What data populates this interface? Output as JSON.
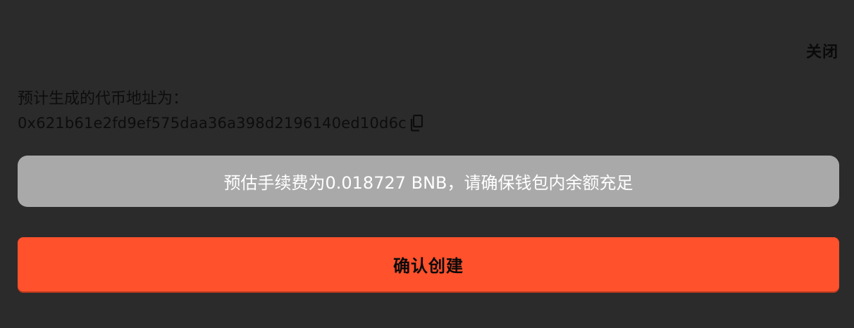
{
  "modal": {
    "close_label": "关闭",
    "address_label": "预计生成的代币地址为：",
    "address_value": "0x621b61e2fd9ef575daa36a398d2196140ed10d6c",
    "copy_icon": "copy-icon",
    "fee_notice": "预估手续费为0.018727 BNB，请确保钱包内余额充足",
    "confirm_label": "确认创建"
  },
  "colors": {
    "background": "#2b2b2b",
    "fee_banner": "#a9a9a9",
    "confirm_button": "#fe512c"
  }
}
